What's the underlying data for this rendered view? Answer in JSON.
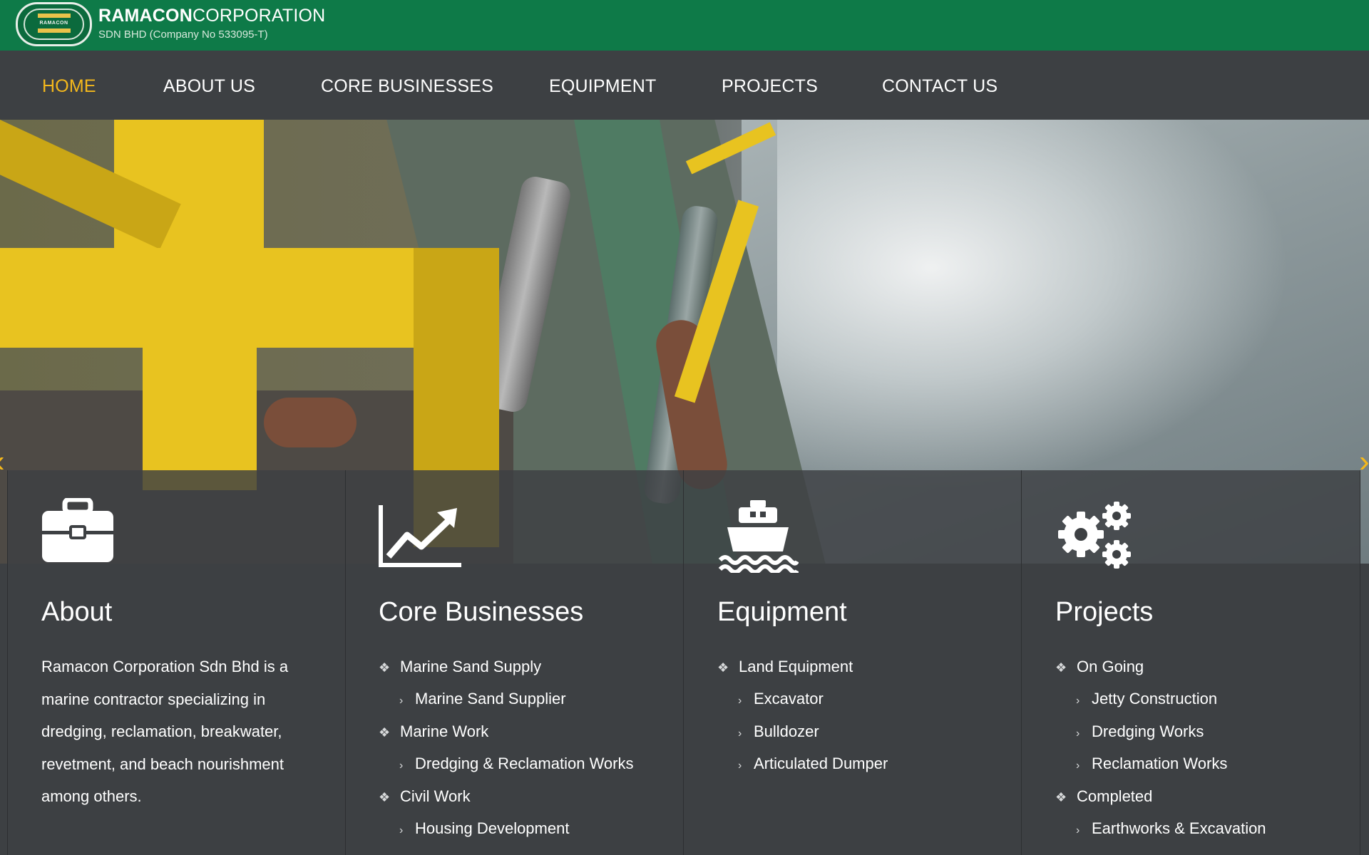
{
  "header": {
    "logo_word": "RAMACON",
    "brand_bold": "RAMACON",
    "brand_thin": "CORPORATION",
    "subtitle": "SDN BHD (Company No 533095-T)"
  },
  "nav": {
    "items": [
      {
        "label": "HOME",
        "active": true
      },
      {
        "label": "ABOUT US"
      },
      {
        "label": "CORE BUSINESSES"
      },
      {
        "label": "EQUIPMENT"
      },
      {
        "label": "PROJECTS"
      },
      {
        "label": "CONTACT US"
      }
    ]
  },
  "hero": {
    "prev_label": "‹",
    "next_label": "›"
  },
  "cards": [
    {
      "title": "About",
      "icon": "briefcase-icon",
      "text": "Ramacon Corporation Sdn Bhd is a marine contractor specializing in dredging, reclamation, breakwater, revetment, and beach nourishment among others."
    },
    {
      "title": "Core Businesses",
      "icon": "trending-up-icon",
      "items": [
        {
          "level": 1,
          "label": "Marine Sand Supply"
        },
        {
          "level": 2,
          "label": "Marine Sand Supplier"
        },
        {
          "level": 1,
          "label": "Marine Work"
        },
        {
          "level": 2,
          "label": "Dredging & Reclamation Works"
        },
        {
          "level": 1,
          "label": "Civil Work"
        },
        {
          "level": 2,
          "label": "Housing Development"
        }
      ]
    },
    {
      "title": "Equipment",
      "icon": "ship-icon",
      "items": [
        {
          "level": 1,
          "label": "Land Equipment"
        },
        {
          "level": 2,
          "label": "Excavator"
        },
        {
          "level": 2,
          "label": "Bulldozer"
        },
        {
          "level": 2,
          "label": "Articulated Dumper"
        }
      ]
    },
    {
      "title": "Projects",
      "icon": "gears-icon",
      "items": [
        {
          "level": 1,
          "label": "On Going"
        },
        {
          "level": 2,
          "label": "Jetty Construction"
        },
        {
          "level": 2,
          "label": "Dredging Works"
        },
        {
          "level": 2,
          "label": "Reclamation Works"
        },
        {
          "level": 1,
          "label": "Completed"
        },
        {
          "level": 2,
          "label": "Earthworks & Excavation"
        }
      ]
    }
  ],
  "colors": {
    "header_green": "#0e7a48",
    "nav_bg": "#3d4043",
    "accent_yellow": "#f4b81c"
  }
}
